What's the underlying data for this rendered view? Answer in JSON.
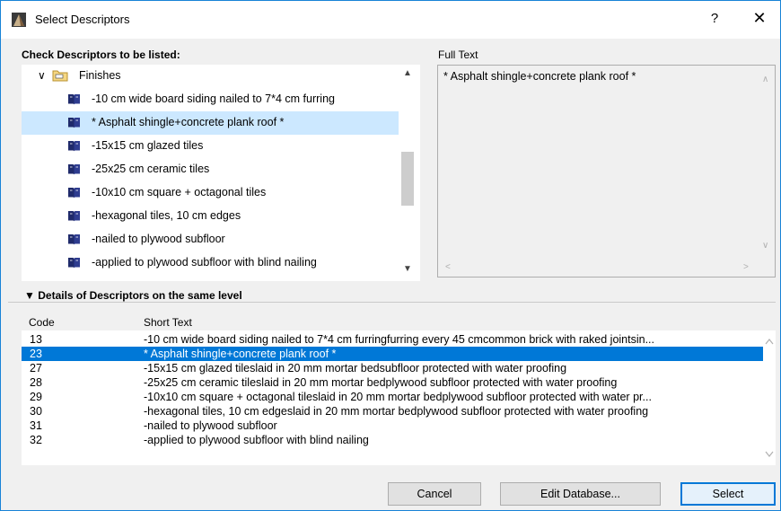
{
  "window": {
    "title": "Select Descriptors",
    "help_label": "?",
    "close_label": "✕"
  },
  "tree": {
    "header": "Check Descriptors to be listed:",
    "folder": {
      "label": "Finishes",
      "expanded": true
    },
    "items": [
      {
        "label": "-10 cm wide board siding nailed to 7*4 cm furring",
        "selected": false
      },
      {
        "label": "* Asphalt shingle+concrete plank roof *",
        "selected": true
      },
      {
        "label": "-15x15 cm glazed tiles",
        "selected": false
      },
      {
        "label": "-25x25 cm ceramic tiles",
        "selected": false
      },
      {
        "label": "-10x10 cm square + octagonal tiles",
        "selected": false
      },
      {
        "label": "-hexagonal tiles, 10 cm edges",
        "selected": false
      },
      {
        "label": "-nailed to plywood subfloor",
        "selected": false
      },
      {
        "label": "-applied to plywood subfloor with blind nailing",
        "selected": false
      }
    ]
  },
  "full_text": {
    "header": "Full Text",
    "value": "* Asphalt shingle+concrete plank roof *"
  },
  "details": {
    "header": "Details of Descriptors on the same level",
    "columns": {
      "code": "Code",
      "short": "Short Text"
    },
    "rows": [
      {
        "code": "13",
        "short": "-10 cm wide board siding nailed to 7*4 cm furringfurring every 45 cmcommon brick with raked jointsin...",
        "selected": false
      },
      {
        "code": "23",
        "short": "* Asphalt shingle+concrete plank roof *",
        "selected": true
      },
      {
        "code": "27",
        "short": "-15x15 cm glazed tileslaid in 20 mm mortar bedsubfloor protected with water proofing",
        "selected": false
      },
      {
        "code": "28",
        "short": "-25x25 cm ceramic tileslaid in 20 mm mortar bedplywood subfloor protected with water proofing",
        "selected": false
      },
      {
        "code": "29",
        "short": "-10x10 cm square + octagonal tileslaid in 20 mm mortar bedplywood subfloor protected with water pr...",
        "selected": false
      },
      {
        "code": "30",
        "short": "-hexagonal tiles, 10 cm edgeslaid in 20 mm mortar bedplywood subfloor protected with water proofing",
        "selected": false
      },
      {
        "code": "31",
        "short": "-nailed to plywood subfloor",
        "selected": false
      },
      {
        "code": "32",
        "short": "-applied to plywood subfloor with blind nailing",
        "selected": false
      }
    ]
  },
  "buttons": {
    "cancel": "Cancel",
    "edit_database": "Edit Database...",
    "select": "Select"
  },
  "colors": {
    "accent": "#0078d7",
    "tree_selection": "#cce8ff",
    "window_border": "#1883d7"
  }
}
